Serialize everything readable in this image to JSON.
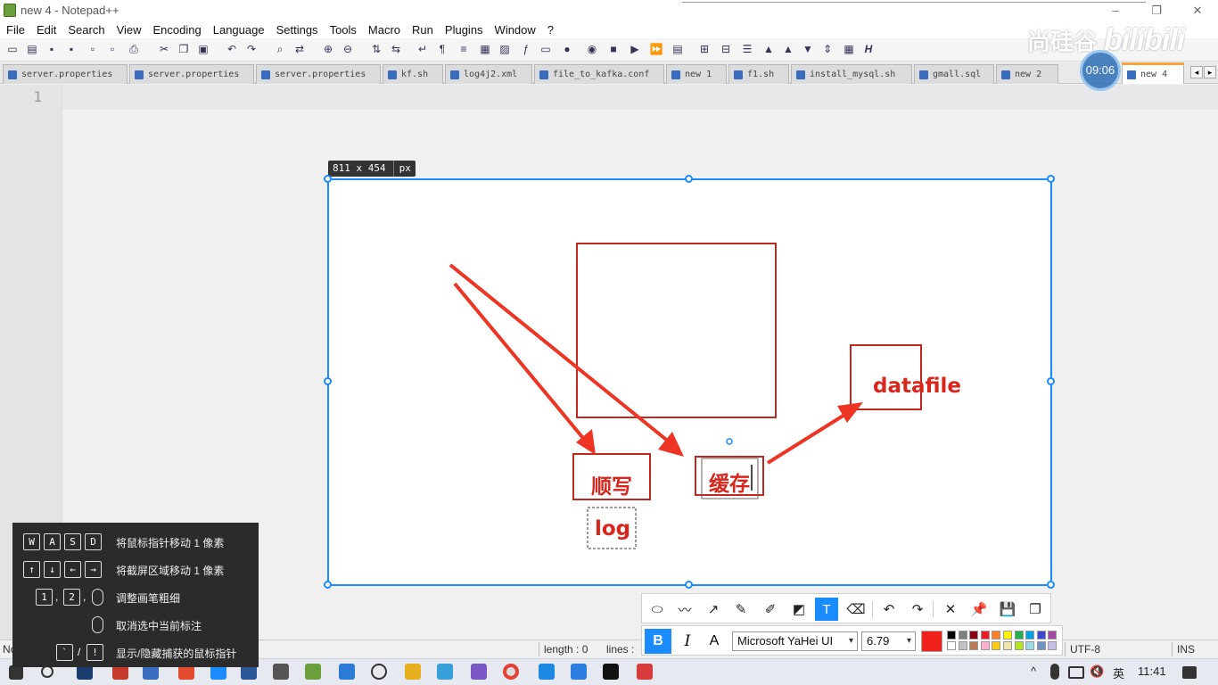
{
  "window": {
    "title": "new 4 - Notepad++",
    "controls": [
      "–",
      "❐",
      "✕"
    ]
  },
  "menu": [
    "File",
    "Edit",
    "Search",
    "View",
    "Encoding",
    "Language",
    "Settings",
    "Tools",
    "Macro",
    "Run",
    "Plugins",
    "Window",
    "?"
  ],
  "tabs": [
    {
      "label": "server.properties",
      "active": false
    },
    {
      "label": "server.properties",
      "active": false
    },
    {
      "label": "server.properties",
      "active": false
    },
    {
      "label": "kf.sh",
      "active": false
    },
    {
      "label": "log4j2.xml",
      "active": false
    },
    {
      "label": "file_to_kafka.conf",
      "active": false
    },
    {
      "label": "new 1",
      "active": false
    },
    {
      "label": "f1.sh",
      "active": false
    },
    {
      "label": "install_mysql.sh",
      "active": false
    },
    {
      "label": "gmall.sql",
      "active": false
    },
    {
      "label": "new 2",
      "active": false
    },
    {
      "label": "new 4",
      "active": true
    }
  ],
  "editor": {
    "line_number": "1"
  },
  "capture": {
    "dimensions": "811 x 454",
    "unit": "px",
    "annotations": {
      "box1": "顺写",
      "box2": "缓存",
      "box3": "datafile",
      "label": "log"
    }
  },
  "text_toolbar": {
    "bold": "B",
    "italic": "I",
    "outline": "A",
    "font": "Microsoft YaHei UI",
    "size": "6.79",
    "current_color": "#f0231c",
    "swatches_row1": [
      "#000000",
      "#7f7f7f",
      "#880015",
      "#ed1c24",
      "#ff7f27",
      "#fff200",
      "#22b14c",
      "#00a2e8",
      "#3f48cc",
      "#a349a4"
    ],
    "swatches_row2": [
      "#ffffff",
      "#c3c3c3",
      "#b97a57",
      "#ffaec9",
      "#ffc90e",
      "#efe4b0",
      "#b5e61d",
      "#99d9ea",
      "#7092be",
      "#c8bfe7"
    ]
  },
  "status": {
    "left": "Normal te",
    "length": "length : 0",
    "lines": "lines :",
    "encoding": "UTF-8",
    "mode": "INS"
  },
  "help": [
    {
      "keys": [
        "W",
        "A",
        "S",
        "D"
      ],
      "desc": "将鼠标指针移动 1 像素"
    },
    {
      "keys": [
        "↑",
        "↓",
        "←",
        "→"
      ],
      "desc": "将截屏区域移动 1 像素"
    },
    {
      "keys": [
        "1",
        ",",
        "2",
        ","
      ],
      "desc": "调整画笔粗细"
    },
    {
      "keys": [],
      "desc": "取消选中当前标注"
    },
    {
      "keys": [
        "`",
        "/",
        "!"
      ],
      "desc": "显示/隐藏捕获的鼠标指针"
    }
  ],
  "watermark": {
    "brand": "尚硅谷",
    "site": "bilibili",
    "timer": "09:06"
  },
  "taskbar": {
    "ime": "英",
    "time": "11:41"
  }
}
